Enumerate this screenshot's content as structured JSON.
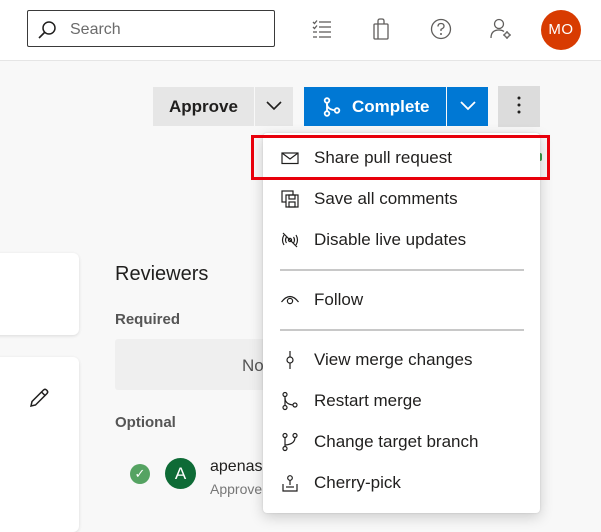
{
  "header": {
    "search_placeholder": "Search",
    "icons": [
      "search-icon",
      "task-list-icon",
      "shopping-bag-icon",
      "help-icon",
      "user-settings-icon"
    ],
    "avatar_initials": "MO",
    "avatar_color": "#d83b01"
  },
  "toolbar": {
    "approve_label": "Approve",
    "complete_label": "Complete",
    "accent_color": "#0078d4"
  },
  "menu": {
    "items": [
      {
        "label": "Share pull request",
        "icon": "mail-icon"
      },
      {
        "label": "Save all comments",
        "icon": "save-all-icon"
      },
      {
        "label": "Disable live updates",
        "icon": "live-updates-icon"
      },
      {
        "label": "Follow",
        "icon": "eye-icon"
      },
      {
        "label": "View merge changes",
        "icon": "commit-icon"
      },
      {
        "label": "Restart merge",
        "icon": "branch-icon"
      },
      {
        "label": "Change target branch",
        "icon": "branch-change-icon"
      },
      {
        "label": "Cherry-pick",
        "icon": "cherry-pick-icon"
      }
    ],
    "highlight_color": "#e8000b"
  },
  "reviewers": {
    "title": "Reviewers",
    "required_label": "Required",
    "required_placeholder": "No",
    "optional_label": "Optional",
    "reviewer": {
      "initial": "A",
      "name": "apenas",
      "status": "Approve"
    }
  }
}
